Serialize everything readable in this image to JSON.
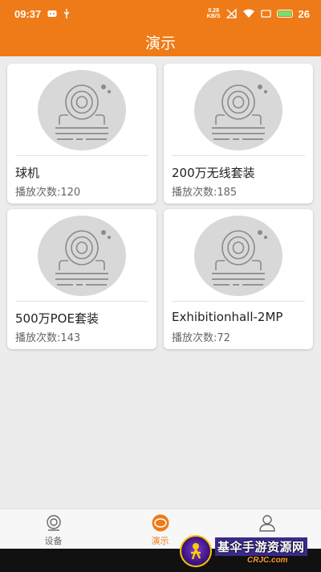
{
  "status_bar": {
    "time": "09:37",
    "net_speed_value": "0.28",
    "net_speed_unit": "KB/S",
    "battery_level": "26"
  },
  "header": {
    "title": "演示"
  },
  "devices": [
    {
      "name": "球机",
      "plays_label": "播放次数:",
      "plays": "120"
    },
    {
      "name": "200万无线套装",
      "plays_label": "播放次数:",
      "plays": "185"
    },
    {
      "name": "500万POE套装",
      "plays_label": "播放次数:",
      "plays": "143"
    },
    {
      "name": "Exhibitionhall-2MP",
      "plays_label": "播放次数:",
      "plays": "72"
    }
  ],
  "bottom_nav": [
    {
      "label": "设备",
      "icon": "camera-icon",
      "active": false
    },
    {
      "label": "演示",
      "icon": "demo-icon",
      "active": true
    },
    {
      "label": "",
      "icon": "user-icon",
      "active": false
    }
  ],
  "watermark": {
    "text": "基伞手游资源网",
    "url": "CRJC.com"
  },
  "colors": {
    "accent": "#ee7b17",
    "background": "#ececec",
    "card": "#ffffff"
  }
}
